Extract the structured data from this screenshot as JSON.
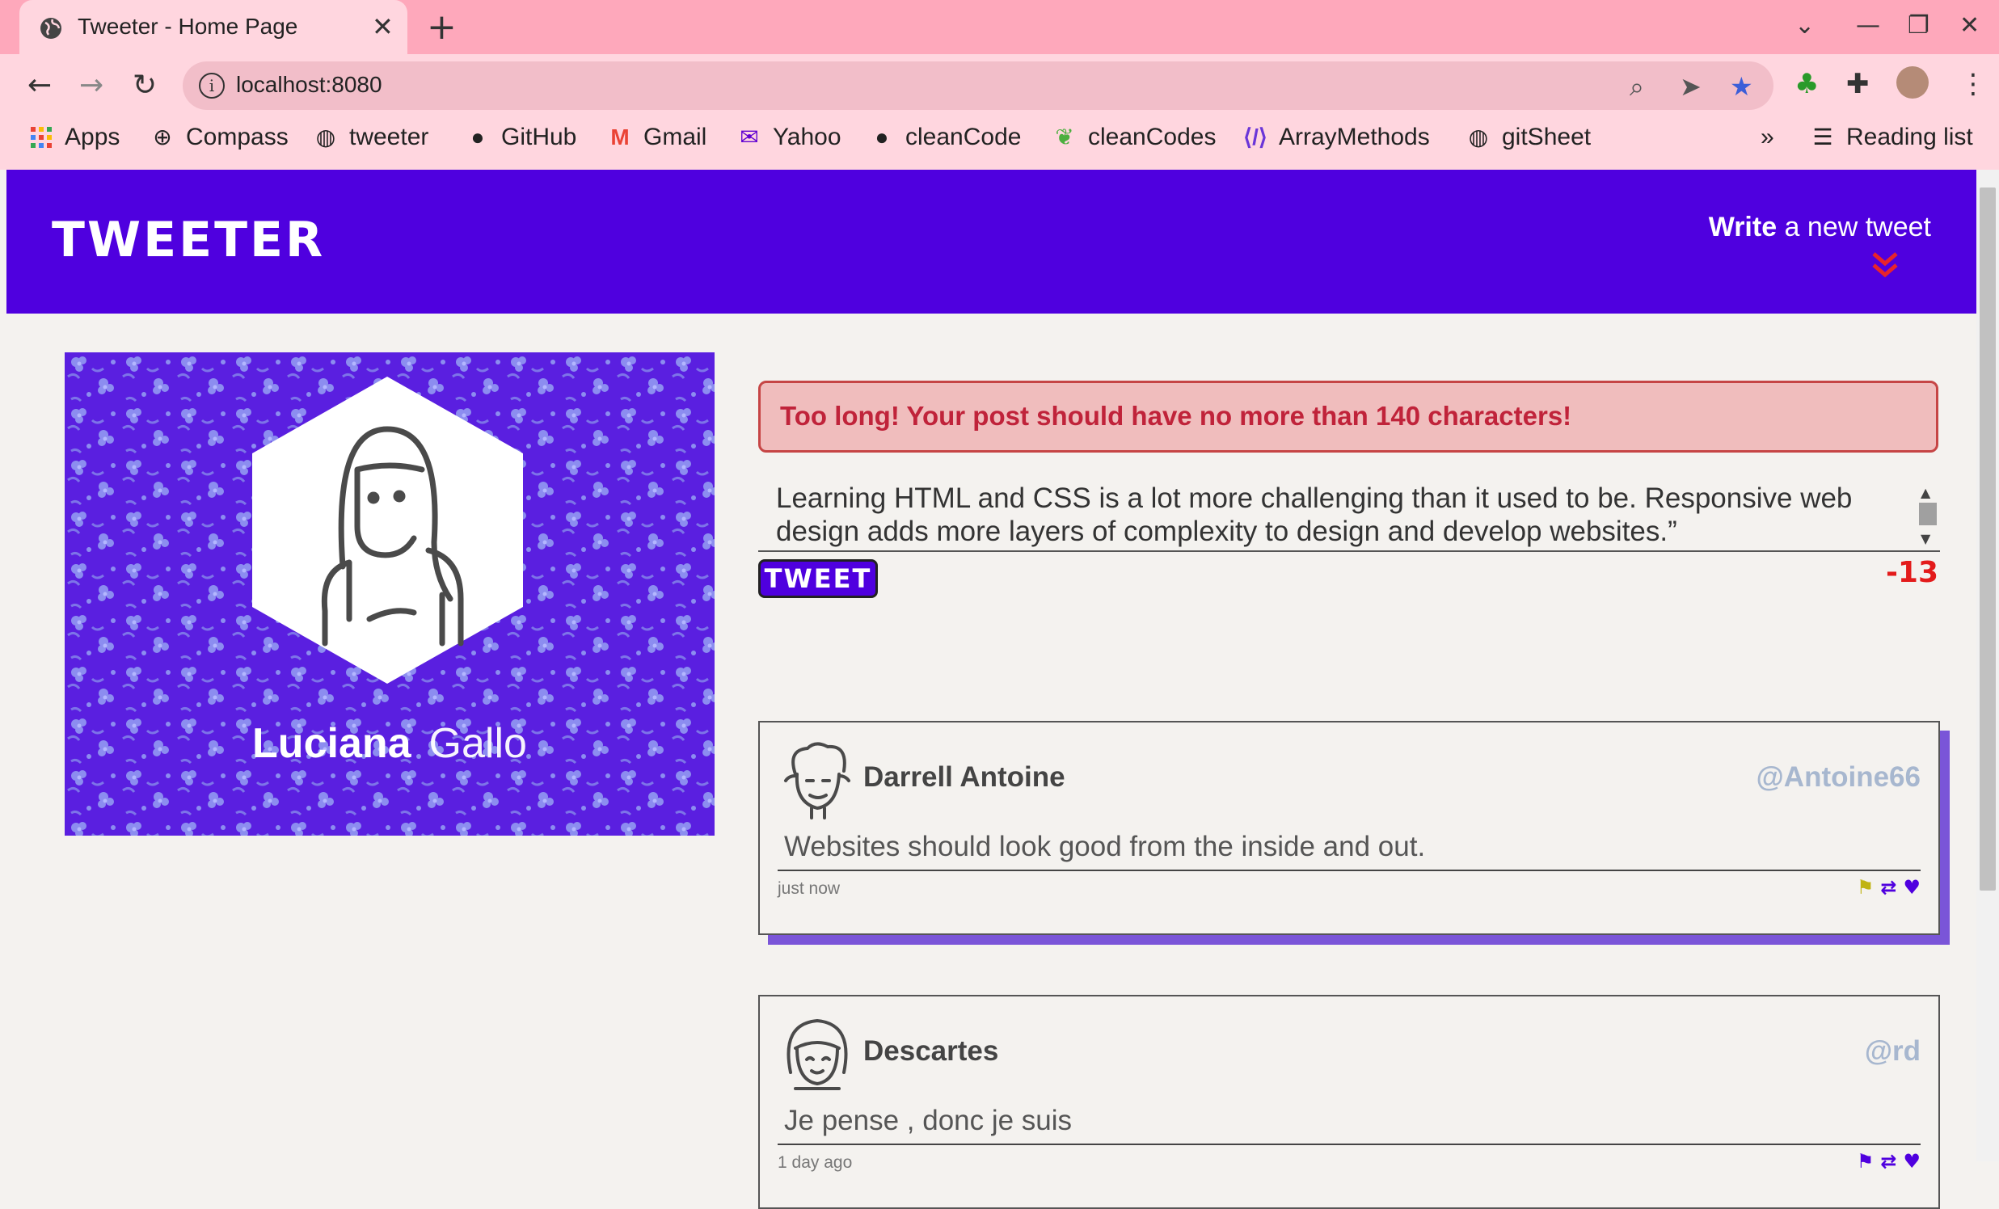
{
  "browser": {
    "tab_title": "Tweeter - Home Page",
    "url": "localhost:8080",
    "bookmarks": [
      {
        "label": "Apps",
        "icon": "apps-grid-icon"
      },
      {
        "label": "Compass",
        "icon": "compass-icon"
      },
      {
        "label": "tweeter",
        "icon": "globe-icon"
      },
      {
        "label": "GitHub",
        "icon": "github-icon"
      },
      {
        "label": "Gmail",
        "icon": "gmail-icon"
      },
      {
        "label": "Yahoo",
        "icon": "yahoo-mail-icon"
      },
      {
        "label": "cleanCode",
        "icon": "github-icon"
      },
      {
        "label": "cleanCodes",
        "icon": "leaf-icon"
      },
      {
        "label": "ArrayMethods",
        "icon": "code-icon"
      },
      {
        "label": "gitSheet",
        "icon": "globe-icon"
      }
    ],
    "overflow_label": "»",
    "reading_list": "Reading list"
  },
  "header": {
    "logo": "TWEETER",
    "write_bold": "Write",
    "write_rest": " a new tweet"
  },
  "profile": {
    "first_name": "Luciana",
    "last_name": "Gallo"
  },
  "compose": {
    "error": "Too long! Your post should have no more than 140 characters!",
    "text": "Learning HTML and CSS is a lot more challenging than it used to be. Responsive web design adds more layers of complexity to design and develop websites.”",
    "button": "TWEET",
    "counter": "-13"
  },
  "tweets": [
    {
      "name": "Darrell Antoine",
      "handle": "@Antoine66",
      "text": "Websites should look good from the inside and out.",
      "time": "just now"
    },
    {
      "name": "Descartes",
      "handle": "@rd",
      "text": "Je pense , donc je suis",
      "time": "1 day ago"
    }
  ],
  "colors": {
    "brand": "#4f00df",
    "error_text": "#c0233a",
    "counter": "#e31b1b",
    "handle": "#a7b7cf"
  }
}
